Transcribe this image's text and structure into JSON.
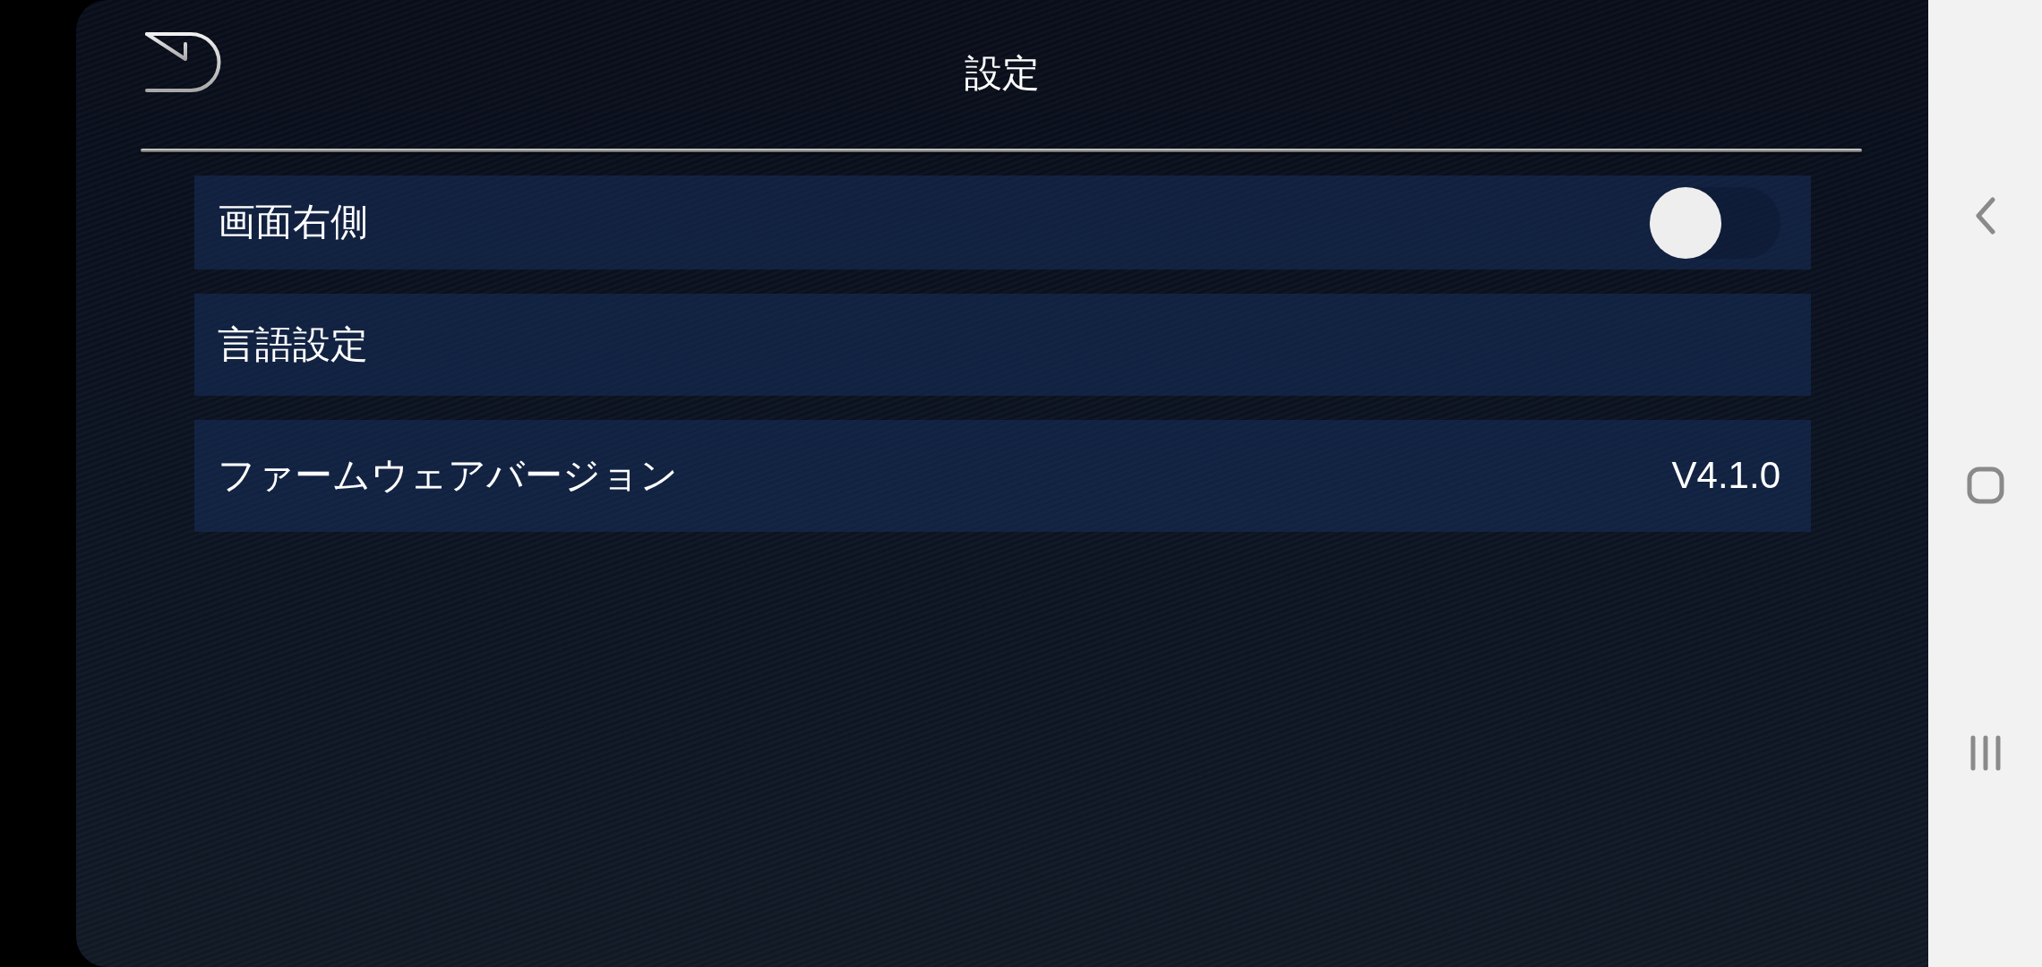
{
  "header": {
    "title": "設定"
  },
  "settings": [
    {
      "kind": "toggle",
      "label": "画面右側",
      "on": false
    },
    {
      "kind": "link",
      "label": "言語設定"
    },
    {
      "kind": "value",
      "label": "ファームウェアバージョン",
      "value": "V4.1.0"
    }
  ]
}
